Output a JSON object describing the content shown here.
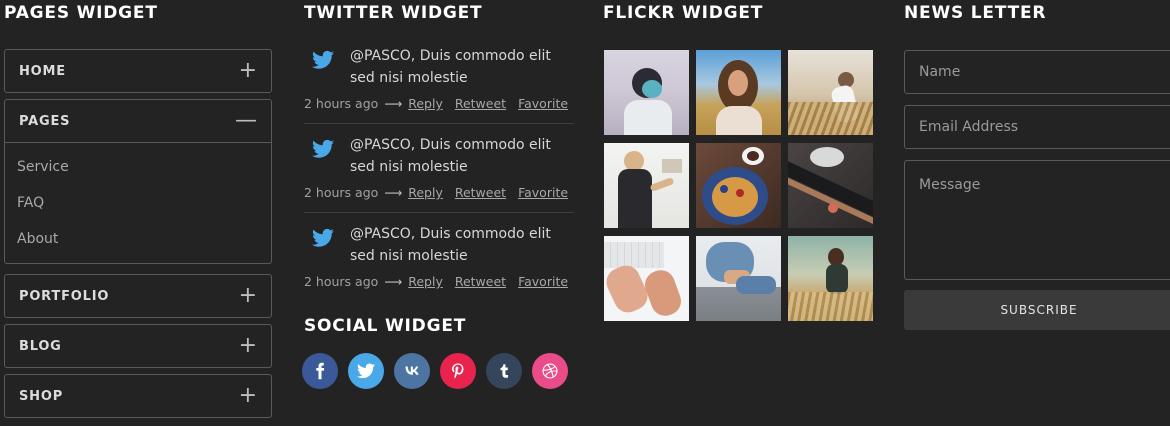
{
  "pages_widget": {
    "title": "PAGES WIDGET",
    "items": [
      {
        "label": "HOME",
        "toggle": "+"
      },
      {
        "label": "PAGES",
        "toggle": "—",
        "sub": [
          "Service",
          "FAQ",
          "About"
        ]
      },
      {
        "label": "PORTFOLIO",
        "toggle": "+"
      },
      {
        "label": "BLOG",
        "toggle": "+"
      },
      {
        "label": "SHOP",
        "toggle": "+"
      }
    ]
  },
  "twitter_widget": {
    "title": "TWITTER WIDGET",
    "tweets": [
      {
        "text": "@PASCO, Duis commodo elit sed nisi molestie",
        "time": "2 hours ago",
        "arrow": "⟶",
        "reply": "Reply",
        "retweet": "Retweet",
        "favorite": "Favorite"
      },
      {
        "text": "@PASCO, Duis commodo elit sed nisi molestie",
        "time": "2 hours ago",
        "arrow": "⟶",
        "reply": "Reply",
        "retweet": "Retweet",
        "favorite": "Favorite"
      },
      {
        "text": "@PASCO, Duis commodo elit sed nisi molestie",
        "time": "2 hours ago",
        "arrow": "⟶",
        "reply": "Reply",
        "retweet": "Retweet",
        "favorite": "Favorite"
      }
    ],
    "icon": "twitter-bird-icon",
    "icon_color": "#4aa8e8"
  },
  "social_widget": {
    "title": "SOCIAL WIDGET",
    "buttons": [
      {
        "icon": "facebook-icon",
        "glyph": "f",
        "color": "#3b5998"
      },
      {
        "icon": "twitter-icon",
        "glyph": "",
        "color": "#4aa8e8"
      },
      {
        "icon": "vk-icon",
        "glyph": "vk",
        "color": "#4c75a3"
      },
      {
        "icon": "pinterest-icon",
        "glyph": "p",
        "color": "#e8234e"
      },
      {
        "icon": "tumblr-icon",
        "glyph": "t",
        "color": "#35465c"
      },
      {
        "icon": "dribbble-icon",
        "glyph": "",
        "color": "#ea4c89"
      }
    ]
  },
  "flickr_widget": {
    "title": "FLICKR WIDGET",
    "photos": [
      "woman-with-cap-photo",
      "curly-hair-woman-photo",
      "man-in-wheat-field-photo",
      "woman-at-whiteboard-photo",
      "waffle-breakfast-photo",
      "desk-items-photo",
      "hands-on-keyboard-photo",
      "person-sitting-jeans-photo",
      "woman-in-field-photo"
    ]
  },
  "newsletter": {
    "title": "NEWS LETTER",
    "name_placeholder": "Name",
    "email_placeholder": "Email Address",
    "message_placeholder": "Message",
    "subscribe_label": "SUBSCRIBE"
  }
}
